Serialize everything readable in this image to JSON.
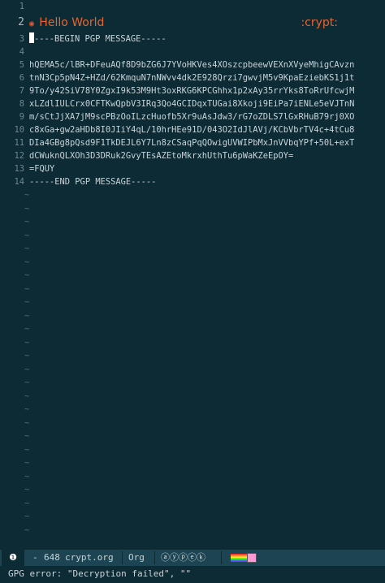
{
  "editor": {
    "lines": [
      {
        "num": "1",
        "text": ""
      },
      {
        "num": "2",
        "bullet": "◉",
        "heading": "Hello World",
        "tag": ":crypt:"
      },
      {
        "num": "3",
        "text": "-----BEGIN PGP MESSAGE-----"
      },
      {
        "num": "4",
        "text": ""
      },
      {
        "num": "5",
        "text": "hQEMA5c/lBR+DFeuAQf8D9bZG6J7YVoHKVes4XOszcpbeewVEXnXVyeMhigCAvzn"
      },
      {
        "num": "6",
        "text": "tnN3Cp5pN4Z+HZd/62KmquN7nNWvv4dk2E928Qrzi7gwvjM5v9KpaEziebKS1j1t"
      },
      {
        "num": "7",
        "text": "9To/y42SiV78Y0ZgxI9k53M9Ht3oxRKG6KPCGhhx1p2xAy35rrYks8ToRrUfcwjM"
      },
      {
        "num": "8",
        "text": "xLZdlIULCrx0CFTKwQpbV3IRq3Qo4GCIDqxTUGai8Xkoji9EiPa7iENLe5eVJTnN"
      },
      {
        "num": "9",
        "text": "m/sCtJjXA7jM9scPBzOoILzcHuofb5Xr9uAsJdw3/rG7oZDLS7lGxRHuB79rj0XO"
      },
      {
        "num": "10",
        "text": "c8xGa+gw2aHDb8I0JIiY4qL/10hrHEe91D/043O2IdJlAVj/KCbVbrTV4c+4tCu8"
      },
      {
        "num": "11",
        "text": "DIa4GBg8pQsd9F1TkDEJL6Y7Ln8zCSaqPqQOwigUVWIPbMxJnVVbqYPf+50L+exT"
      },
      {
        "num": "12",
        "text": "dCWuknQLXOh3D3DRuk2GvyTEsAZEtoMkrxhUthTu6pWaKZeEpOY="
      },
      {
        "num": "13",
        "text": "=FQUY"
      },
      {
        "num": "14",
        "text": "-----END PGP MESSAGE-----"
      }
    ],
    "empty_marker": "~"
  },
  "modeline": {
    "window_number": "❶",
    "modified": "-",
    "buffer_size": "648",
    "buffer_name": "crypt.org",
    "major_mode": "Org",
    "minor_modes": "ⓐⓨⓟⓔⓚ"
  },
  "echo_area": {
    "message": "GPG error: \"Decryption failed\", \"\""
  }
}
